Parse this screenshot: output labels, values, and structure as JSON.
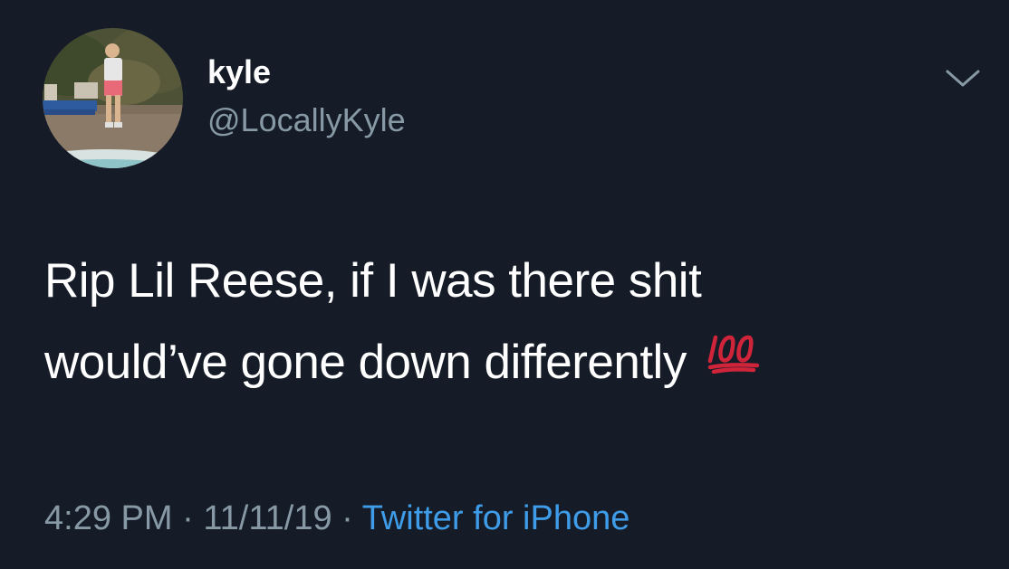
{
  "tweet": {
    "author": {
      "display_name": "kyle",
      "handle": "@LocallyKyle"
    },
    "text_lines": [
      "Rip Lil Reese, if I was there shit",
      "would’ve gone down differently"
    ],
    "emoji": "100-emoji",
    "meta": {
      "time": "4:29 PM",
      "separator": "·",
      "date": "11/11/19",
      "source": "Twitter for iPhone"
    }
  },
  "colors": {
    "background": "#151c28",
    "primary_text": "#ffffff",
    "secondary_text": "#8899a6",
    "link": "#3e9ce8",
    "emoji_red": "#d0243a"
  },
  "icons": {
    "menu": "chevron-down-icon",
    "avatar": "avatar-photo"
  }
}
